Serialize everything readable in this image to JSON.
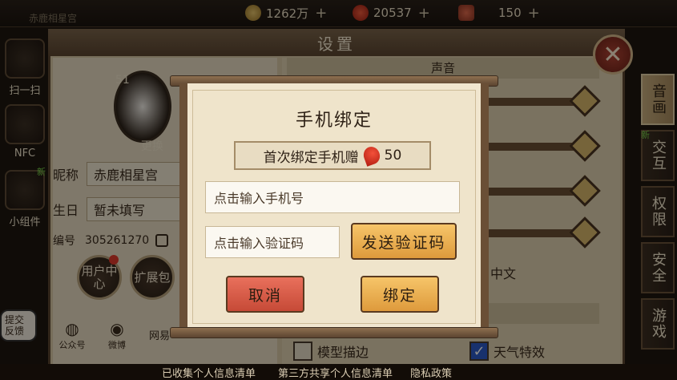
{
  "topbar": {
    "player_name": "赤鹿相星宫",
    "currency1": "1262万",
    "currency2": "20537",
    "currency3": "150"
  },
  "rail": {
    "scan": "扫一扫",
    "nfc": "NFC",
    "widget_new": "新",
    "widget": "小组件",
    "feedback": "提交\n反馈"
  },
  "settings": {
    "title": "设置",
    "level": "51",
    "change_avatar": "更换",
    "nickname_label": "昵称",
    "nickname_value": "赤鹿相星宫",
    "birthday_label": "生日",
    "birthday_value": "暂未填写",
    "id_label": "编号",
    "id_value": "305261270",
    "user_center": "用户中心",
    "expansion": "扩展包",
    "wechat": "公众号",
    "weibo": "微博",
    "netease": "网易",
    "sound_header": "声音",
    "language": "中文",
    "model_outline": "模型描边",
    "weather_fx": "天气特效",
    "new_tag": "新"
  },
  "tabs": [
    "音画",
    "交互",
    "权限",
    "安全",
    "游戏"
  ],
  "dialog": {
    "title": "手机绑定",
    "bonus_text": "首次绑定手机赠",
    "bonus_amount": "50",
    "phone_placeholder": "点击输入手机号",
    "code_placeholder": "点击输入验证码",
    "send_code": "发送验证码",
    "cancel": "取消",
    "bind": "绑定"
  },
  "footer": {
    "collected": "已收集个人信息清单",
    "shared": "第三方共享个人信息清单",
    "privacy": "隐私政策"
  },
  "colors": {
    "accent_gold": "#de9a3c",
    "cancel_red": "#c64a37",
    "panel_bg": "#d7c7a4"
  }
}
